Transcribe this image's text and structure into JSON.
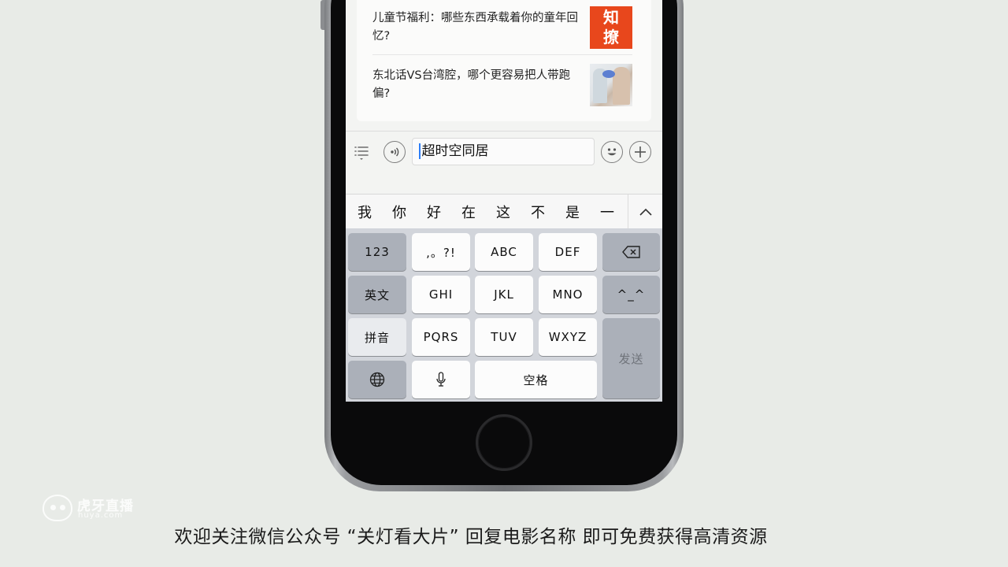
{
  "articles": [
    {
      "title": "儿童节福利：哪些东西承载着你的童年回忆?",
      "thumb_text": "知\n撩"
    },
    {
      "title": "东北话VS台湾腔，哪个更容易把人带跑偏?"
    }
  ],
  "input_bar": {
    "menu_icon": "list-icon",
    "voice_icon": "voice-icon",
    "text_value": "超时空同居",
    "emoji_icon": "smiley-icon",
    "plus_icon": "plus-icon"
  },
  "candidates": {
    "items": [
      "我",
      "你",
      "好",
      "在",
      "这",
      "不",
      "是",
      "一"
    ],
    "expand_icon": "chevron-up-icon"
  },
  "keyboard": {
    "numbers": "123",
    "punct": ",。?!",
    "abc": "ABC",
    "def": "DEF",
    "backspace_icon": "backspace-icon",
    "english": "英文",
    "ghi": "GHI",
    "jkl": "JKL",
    "mno": "MNO",
    "emoticon": "^_^",
    "pinyin": "拼音",
    "pqrs": "PQRS",
    "tuv": "TUV",
    "wxyz": "WXYZ",
    "send": "发送",
    "globe_icon": "globe-icon",
    "mic_icon": "microphone-icon",
    "space": "空格"
  },
  "watermark": {
    "name": "虎牙直播",
    "url": "huya.com"
  },
  "subtitle": "欢迎关注微信公众号 “关灯看大片” 回复电影名称 即可免费获得高清资源",
  "colors": {
    "background": "#e8ebe7",
    "thumb_accent": "#e8471c",
    "keyboard": "#d2d5db",
    "caret": "#2d7ef7"
  }
}
